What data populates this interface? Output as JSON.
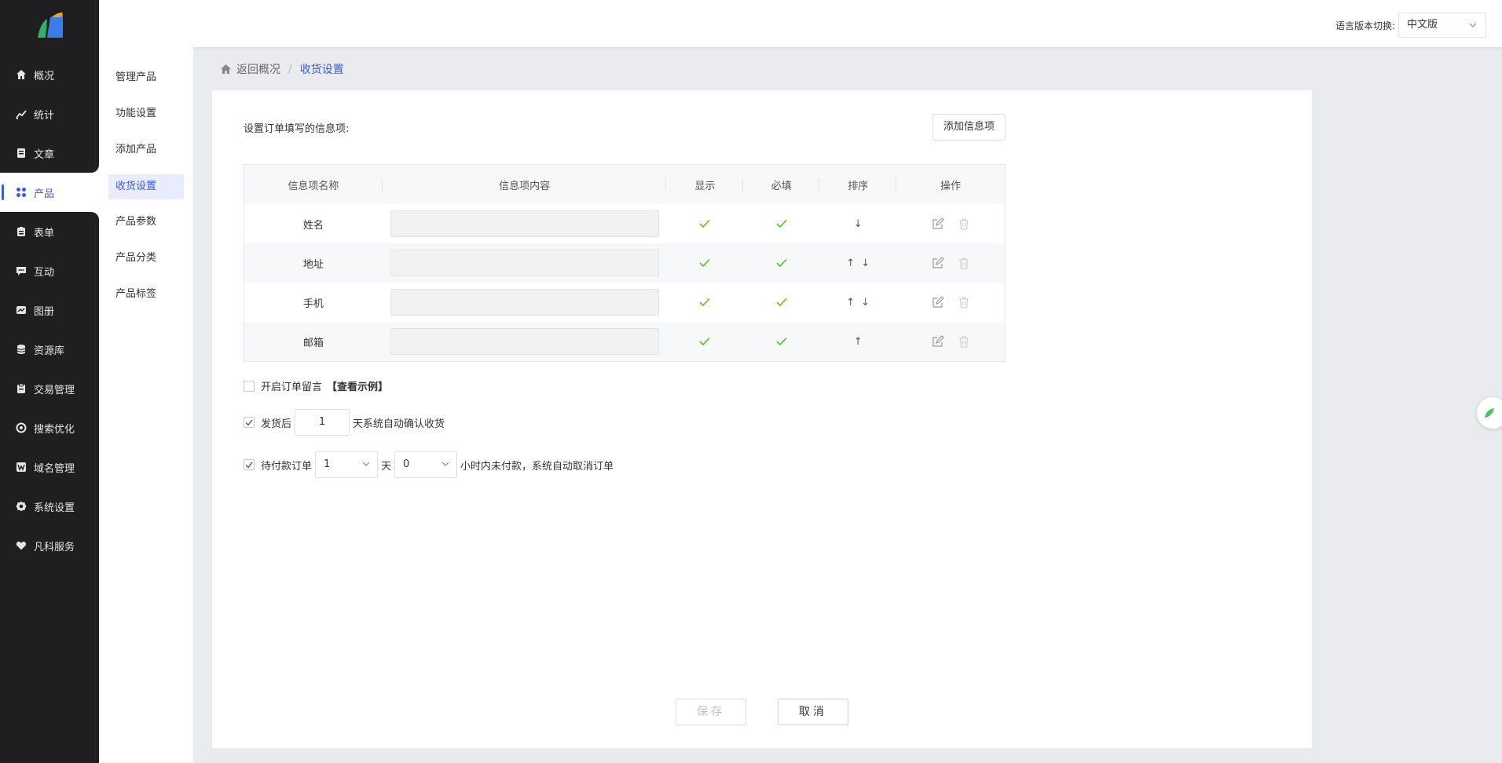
{
  "nav": {
    "items": [
      {
        "label": "概况",
        "icon": "home-icon"
      },
      {
        "label": "统计",
        "icon": "chart-icon"
      },
      {
        "label": "文章",
        "icon": "document-icon"
      },
      {
        "label": "产品",
        "icon": "grid-icon"
      },
      {
        "label": "表单",
        "icon": "clipboard-icon"
      },
      {
        "label": "互动",
        "icon": "chat-icon"
      },
      {
        "label": "图册",
        "icon": "album-icon"
      },
      {
        "label": "资源库",
        "icon": "database-icon"
      },
      {
        "label": "交易管理",
        "icon": "order-icon"
      },
      {
        "label": "搜索优化",
        "icon": "seo-icon"
      },
      {
        "label": "域名管理",
        "icon": "w-icon"
      },
      {
        "label": "系统设置",
        "icon": "gear-icon"
      },
      {
        "label": "凡科服务",
        "icon": "heart-icon"
      }
    ],
    "active_index": 3
  },
  "subnav": {
    "items": [
      "管理产品",
      "功能设置",
      "添加产品",
      "收货设置",
      "产品参数",
      "产品分类",
      "产品标签"
    ],
    "active_index": 3
  },
  "topbar": {
    "lang_label": "语言版本切换:",
    "lang_value": "中文版"
  },
  "breadcrumb": {
    "back": "返回概况",
    "sep": "/",
    "current": "收货设置"
  },
  "section": {
    "title": "设置订单填写的信息项:",
    "add_button": "添加信息项"
  },
  "table": {
    "headers": [
      "信息项名称",
      "信息项内容",
      "显示",
      "必填",
      "排序",
      "操作"
    ],
    "rows": [
      {
        "name": "姓名",
        "up": false,
        "down": true
      },
      {
        "name": "地址",
        "up": true,
        "down": true
      },
      {
        "name": "手机",
        "up": true,
        "down": true
      },
      {
        "name": "邮箱",
        "up": true,
        "down": false
      }
    ]
  },
  "options": {
    "order_message_label": "开启订单留言",
    "order_message_checked": false,
    "example_link": "【查看示例】",
    "auto_confirm_prefix": "发货后",
    "auto_confirm_days": "1",
    "auto_confirm_suffix": "天系统自动确认收货",
    "auto_confirm_checked": true,
    "pending_label": "待付款订单",
    "pending_checked": true,
    "pending_days": "1",
    "pending_day_unit": "天",
    "pending_hours": "0",
    "pending_suffix": "小时内未付款，系统自动取消订单"
  },
  "footer": {
    "save": "保存",
    "cancel": "取消"
  },
  "colors": {
    "accent": "#3b5bdb",
    "nav_bg": "#1f1f21",
    "check": "#52c41a"
  }
}
